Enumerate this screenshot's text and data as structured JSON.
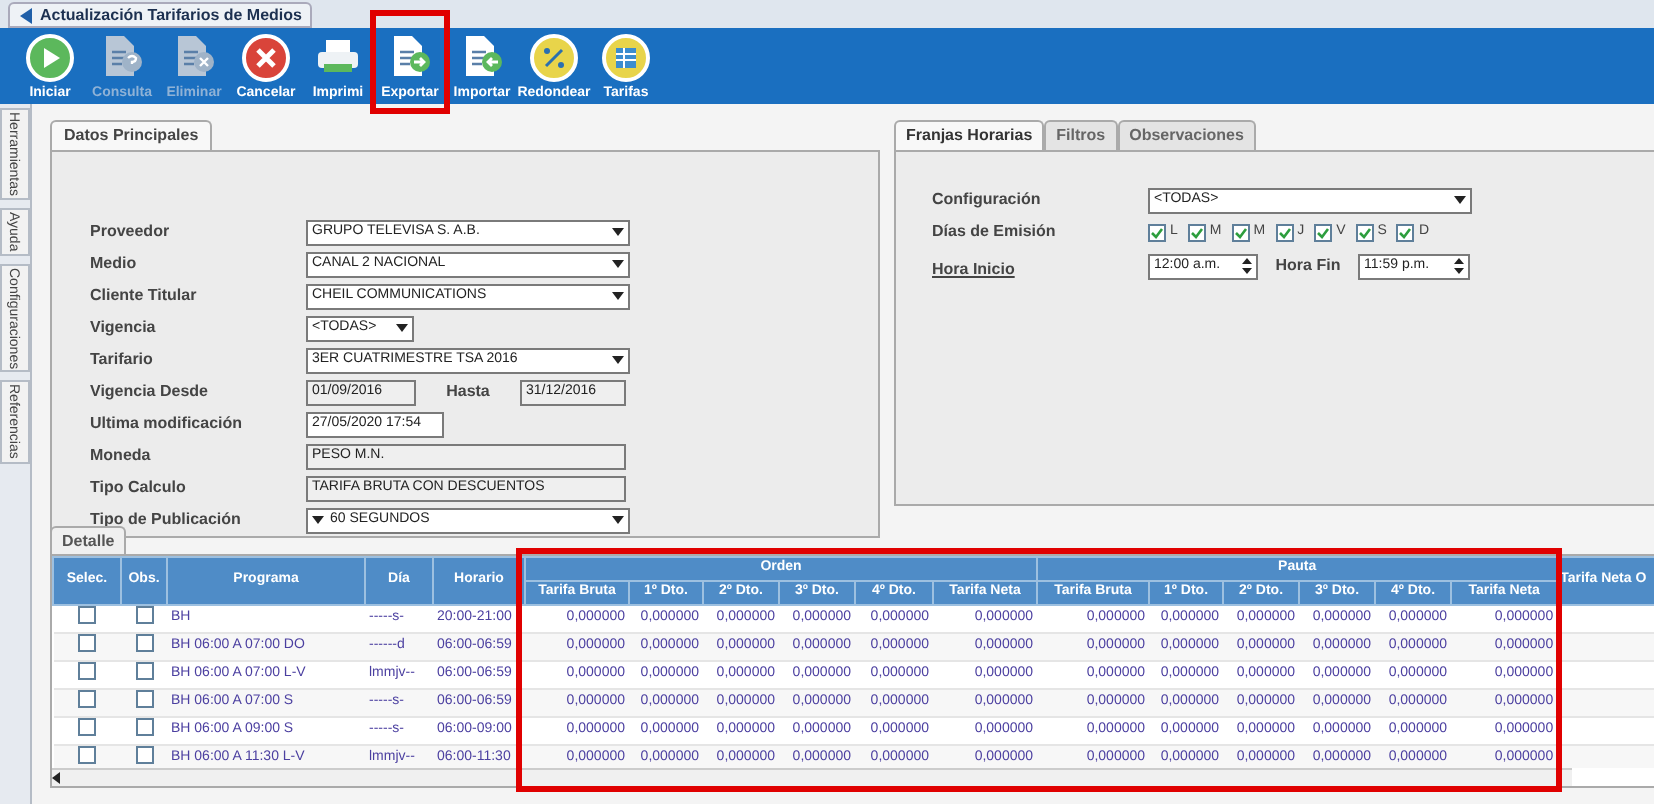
{
  "window": {
    "title": "Actualización Tarifarios de Medios"
  },
  "toolbar": [
    {
      "label": "Iniciar",
      "kind": "play",
      "disabled": false
    },
    {
      "label": "Consulta",
      "kind": "query",
      "disabled": true
    },
    {
      "label": "Eliminar",
      "kind": "delete",
      "disabled": true
    },
    {
      "label": "Cancelar",
      "kind": "cancel",
      "disabled": false
    },
    {
      "label": "Imprimi",
      "kind": "print",
      "disabled": false
    },
    {
      "label": "Exportar",
      "kind": "export",
      "disabled": false
    },
    {
      "label": "Importar",
      "kind": "import",
      "disabled": false
    },
    {
      "label": "Redondear",
      "kind": "round",
      "disabled": false
    },
    {
      "label": "Tarifas",
      "kind": "rates",
      "disabled": false
    }
  ],
  "side_tabs": [
    "Herramientas",
    "Ayuda",
    "Configuraciones",
    "Referencias"
  ],
  "main_panel": {
    "tab": "Datos Principales",
    "fields": [
      {
        "label": "Proveedor",
        "kind": "select",
        "value": "GRUPO TELEVISA S. A.B."
      },
      {
        "label": "Medio",
        "kind": "select",
        "value": "CANAL 2 NACIONAL"
      },
      {
        "label": "Cliente Titular",
        "kind": "select",
        "value": "CHEIL COMMUNICATIONS"
      },
      {
        "label": "Vigencia",
        "kind": "small_select",
        "value": "<TODAS>"
      },
      {
        "label": "Tarifario",
        "kind": "select",
        "value": "3ER CUATRIMESTRE TSA 2016"
      },
      {
        "label": "Vigencia Desde",
        "kind": "range",
        "value": "01/09/2016",
        "second_label": "Hasta",
        "second_value": "31/12/2016"
      },
      {
        "label": "Ultima modificación",
        "kind": "short_text",
        "value": "27/05/2020  17:54"
      },
      {
        "label": "Moneda",
        "kind": "readonly",
        "value": "PESO M.N."
      },
      {
        "label": "Tipo Calculo",
        "kind": "readonly",
        "value": "TARIFA BRUTA CON DESCUENTOS"
      },
      {
        "label": "Tipo de Publicación",
        "kind": "select_marked",
        "value": "60 SEGUNDOS"
      }
    ]
  },
  "side_panel": {
    "tabs": [
      {
        "label": "Franjas Horarias",
        "selected": true
      },
      {
        "label": "Filtros",
        "selected": false
      },
      {
        "label": "Observaciones",
        "selected": false
      }
    ],
    "configuration": {
      "label": "Configuración",
      "value": "<TODAS>"
    },
    "days": {
      "label": "Días de Emisión",
      "items": [
        {
          "label": "L",
          "checked": true
        },
        {
          "label": "M",
          "checked": true
        },
        {
          "label": "M",
          "checked": true
        },
        {
          "label": "J",
          "checked": true
        },
        {
          "label": "V",
          "checked": true
        },
        {
          "label": "S",
          "checked": true
        },
        {
          "label": "D",
          "checked": true
        }
      ]
    },
    "hours": {
      "label": "Hora Inicio",
      "value": "12:00 a.m.",
      "second_label": "Hora Fin",
      "second_value": "11:59 p.m."
    }
  },
  "detail": {
    "tab": "Detalle",
    "columns": [
      "Selec.",
      "Obs.",
      "Programa",
      "Día",
      "Horario"
    ],
    "groups": [
      {
        "name": "Orden",
        "columns": [
          "Tarifa Bruta",
          "1º Dto.",
          "2º Dto.",
          "3º Dto.",
          "4º Dto.",
          "Tarifa Neta"
        ]
      },
      {
        "name": "Pauta",
        "columns": [
          "Tarifa Bruta",
          "1º Dto.",
          "2º Dto.",
          "3º Dto.",
          "4º Dto.",
          "Tarifa Neta"
        ]
      }
    ],
    "trailing_column": "Tarifa Neta O",
    "rows": [
      {
        "selected": false,
        "obs": false,
        "program": "BH",
        "days": "-----s-",
        "time": "20:00-21:00",
        "orden": [
          "0,000000",
          "0,000000",
          "0,000000",
          "0,000000",
          "0,000000",
          "0,000000"
        ],
        "pauta": [
          "0,000000",
          "0,000000",
          "0,000000",
          "0,000000",
          "0,000000",
          "0,000000"
        ]
      },
      {
        "selected": false,
        "obs": false,
        "program": "BH 06:00 A 07:00 DO",
        "days": "------d",
        "time": "06:00-06:59",
        "orden": [
          "0,000000",
          "0,000000",
          "0,000000",
          "0,000000",
          "0,000000",
          "0,000000"
        ],
        "pauta": [
          "0,000000",
          "0,000000",
          "0,000000",
          "0,000000",
          "0,000000",
          "0,000000"
        ]
      },
      {
        "selected": false,
        "obs": false,
        "program": "BH 06:00 A 07:00 L-V",
        "days": "lmmjv--",
        "time": "06:00-06:59",
        "orden": [
          "0,000000",
          "0,000000",
          "0,000000",
          "0,000000",
          "0,000000",
          "0,000000"
        ],
        "pauta": [
          "0,000000",
          "0,000000",
          "0,000000",
          "0,000000",
          "0,000000",
          "0,000000"
        ]
      },
      {
        "selected": false,
        "obs": false,
        "program": "BH 06:00 A 07:00 S",
        "days": "-----s-",
        "time": "06:00-06:59",
        "orden": [
          "0,000000",
          "0,000000",
          "0,000000",
          "0,000000",
          "0,000000",
          "0,000000"
        ],
        "pauta": [
          "0,000000",
          "0,000000",
          "0,000000",
          "0,000000",
          "0,000000",
          "0,000000"
        ]
      },
      {
        "selected": false,
        "obs": false,
        "program": "BH 06:00 A 09:00 S",
        "days": "-----s-",
        "time": "06:00-09:00",
        "orden": [
          "0,000000",
          "0,000000",
          "0,000000",
          "0,000000",
          "0,000000",
          "0,000000"
        ],
        "pauta": [
          "0,000000",
          "0,000000",
          "0,000000",
          "0,000000",
          "0,000000",
          "0,000000"
        ]
      },
      {
        "selected": false,
        "obs": false,
        "program": "BH 06:00 A 11:30 L-V",
        "days": "lmmjv--",
        "time": "06:00-11:30",
        "orden": [
          "0,000000",
          "0,000000",
          "0,000000",
          "0,000000",
          "0,000000",
          "0,000000"
        ],
        "pauta": [
          "0,000000",
          "0,000000",
          "0,000000",
          "0,000000",
          "0,000000",
          "0,000000"
        ]
      }
    ]
  }
}
